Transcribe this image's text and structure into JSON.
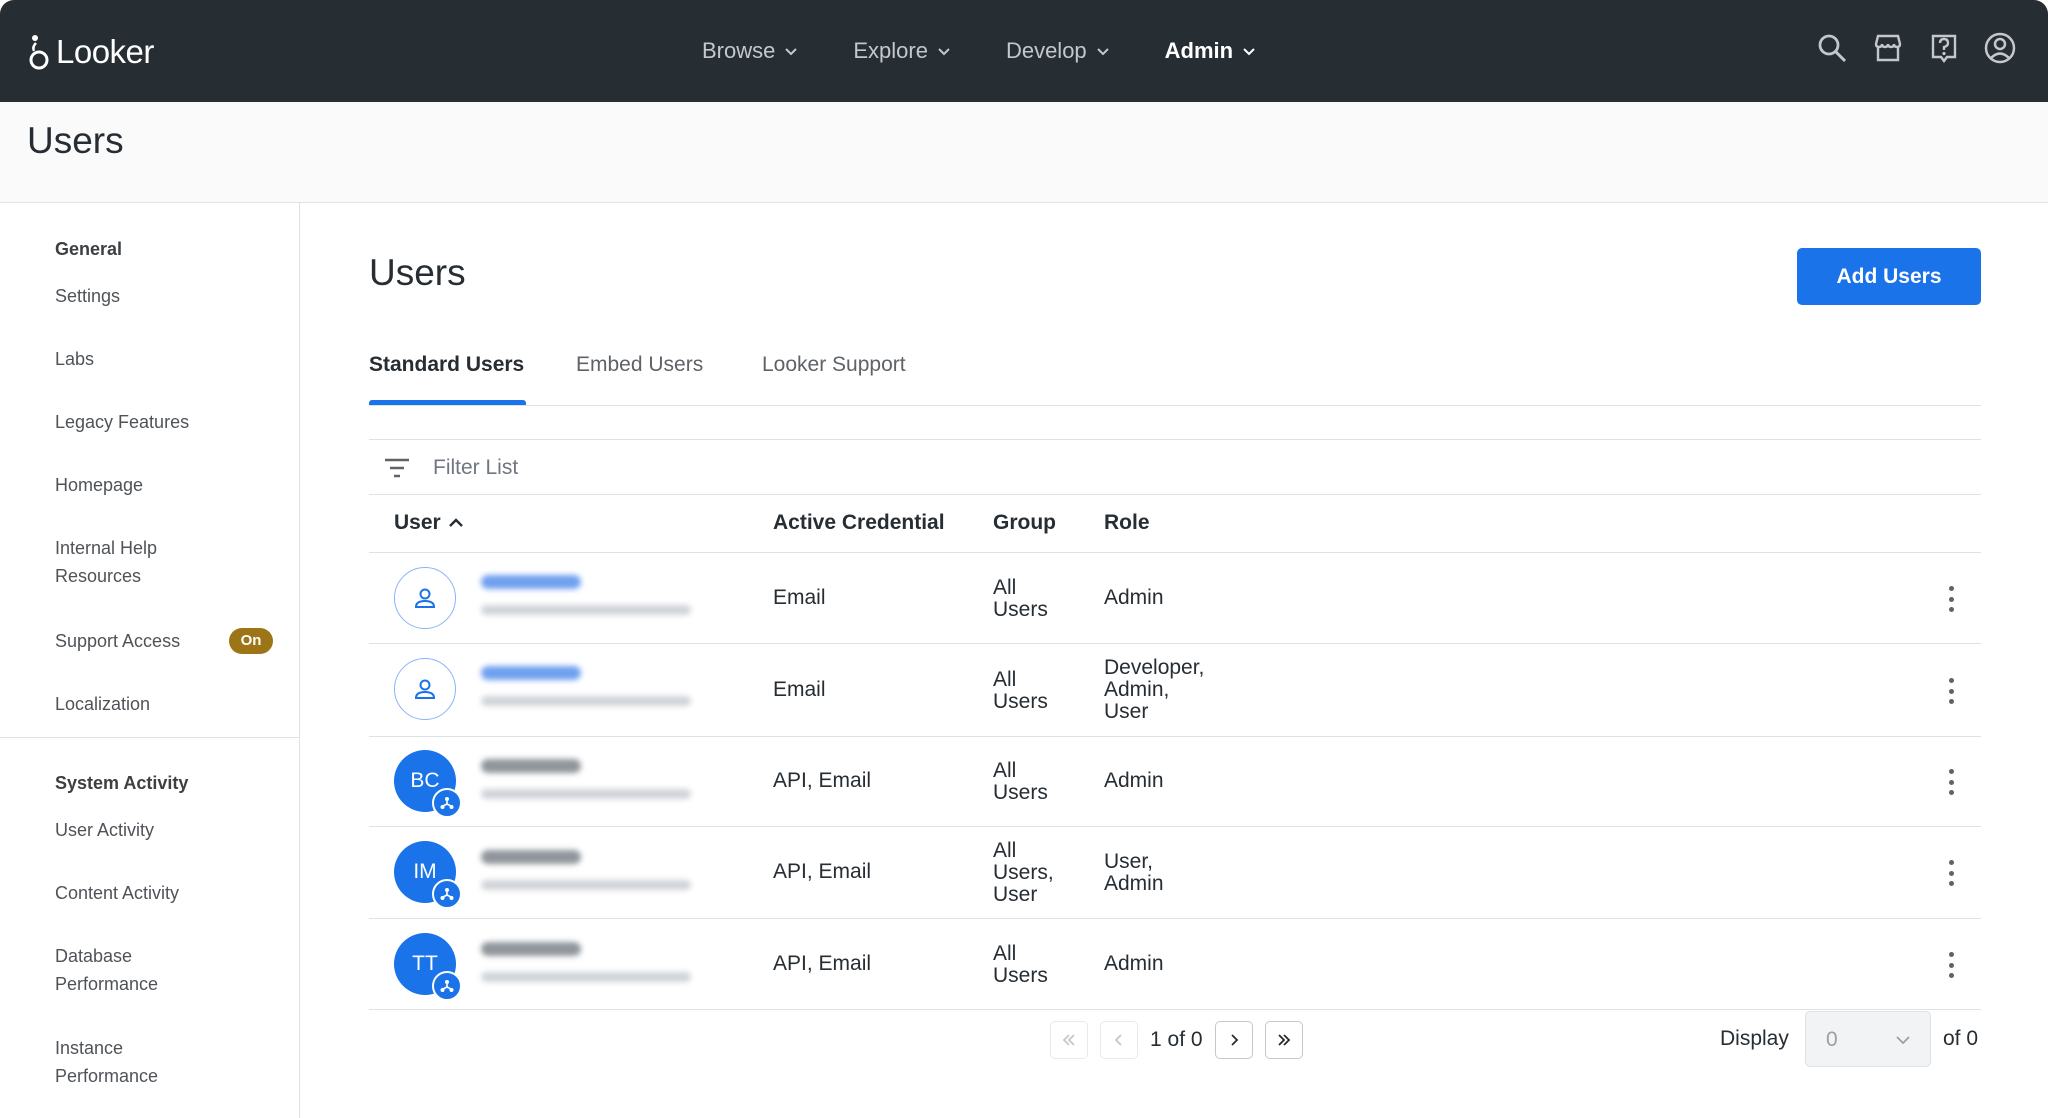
{
  "app": {
    "name": "Looker"
  },
  "nav": {
    "items": [
      {
        "label": "Browse",
        "active": false
      },
      {
        "label": "Explore",
        "active": false
      },
      {
        "label": "Develop",
        "active": false
      },
      {
        "label": "Admin",
        "active": true
      }
    ],
    "icons": [
      "search-icon",
      "marketplace-icon",
      "help-icon",
      "account-icon"
    ]
  },
  "page": {
    "title": "Users"
  },
  "sidebar": {
    "general_heading": "General",
    "general_items": [
      {
        "label": "Settings"
      },
      {
        "label": "Labs"
      },
      {
        "label": "Legacy Features"
      },
      {
        "label": "Homepage"
      },
      {
        "label": "Internal Help Resources"
      },
      {
        "label": "Support Access",
        "badge": "On"
      },
      {
        "label": "Localization"
      }
    ],
    "system_heading": "System Activity",
    "system_items": [
      {
        "label": "User Activity"
      },
      {
        "label": "Content Activity"
      },
      {
        "label": "Database Performance"
      },
      {
        "label": "Instance Performance"
      }
    ]
  },
  "main": {
    "title": "Users",
    "add_button": "Add Users",
    "tabs": [
      {
        "label": "Standard Users",
        "active": true
      },
      {
        "label": "Embed Users",
        "active": false
      },
      {
        "label": "Looker Support",
        "active": false
      }
    ],
    "filter_placeholder": "Filter List",
    "columns": [
      "User",
      "Active Credential",
      "Group",
      "Role"
    ],
    "rows": [
      {
        "initials": "",
        "avatar": "outline",
        "credential": "Email",
        "group": [
          "All",
          "Users"
        ],
        "role": [
          "Admin"
        ]
      },
      {
        "initials": "",
        "avatar": "outline",
        "credential": "Email",
        "group": [
          "All",
          "Users"
        ],
        "role": [
          "Developer,",
          "Admin,",
          "User"
        ]
      },
      {
        "initials": "BC",
        "avatar": "solid",
        "credential": "API, Email",
        "group": [
          "All",
          "Users"
        ],
        "role": [
          "Admin"
        ]
      },
      {
        "initials": "IM",
        "avatar": "solid",
        "credential": "API, Email",
        "group": [
          "All",
          "Users,",
          "User"
        ],
        "role": [
          "User,",
          "Admin"
        ]
      },
      {
        "initials": "TT",
        "avatar": "solid",
        "credential": "API, Email",
        "group": [
          "All",
          "Users"
        ],
        "role": [
          "Admin"
        ]
      }
    ],
    "pagination": {
      "text": "1 of 0",
      "display_label": "Display",
      "display_value": "0",
      "of_label": "of 0"
    }
  },
  "colors": {
    "nav_bg": "#262d33",
    "accent": "#1a73e8",
    "badge": "#9e7516"
  }
}
